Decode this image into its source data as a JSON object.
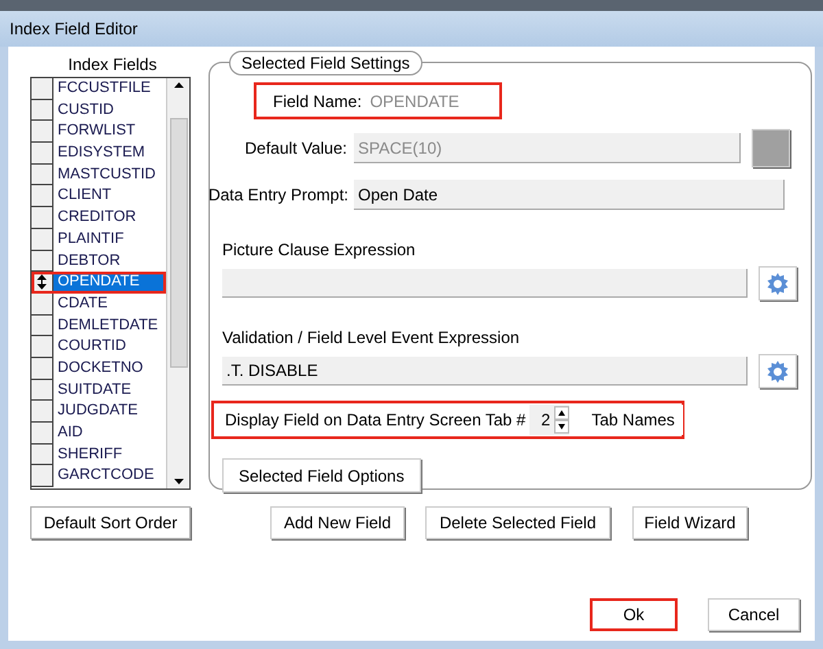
{
  "window": {
    "title": "Index Field Editor"
  },
  "index_fields": {
    "label": "Index Fields",
    "items": [
      {
        "name": "FCCUSTFILE",
        "selected": false
      },
      {
        "name": "CUSTID",
        "selected": false
      },
      {
        "name": "FORWLIST",
        "selected": false
      },
      {
        "name": "EDISYSTEM",
        "selected": false
      },
      {
        "name": "MASTCUSTID",
        "selected": false
      },
      {
        "name": "CLIENT",
        "selected": false
      },
      {
        "name": "CREDITOR",
        "selected": false
      },
      {
        "name": "PLAINTIF",
        "selected": false
      },
      {
        "name": "DEBTOR",
        "selected": false
      },
      {
        "name": "OPENDATE",
        "selected": true
      },
      {
        "name": "CDATE",
        "selected": false
      },
      {
        "name": "DEMLETDATE",
        "selected": false
      },
      {
        "name": "COURTID",
        "selected": false
      },
      {
        "name": "DOCKETNO",
        "selected": false
      },
      {
        "name": "SUITDATE",
        "selected": false
      },
      {
        "name": "JUDGDATE",
        "selected": false
      },
      {
        "name": "AID",
        "selected": false
      },
      {
        "name": "SHERIFF",
        "selected": false
      },
      {
        "name": "GARCTCODE",
        "selected": false
      }
    ]
  },
  "settings": {
    "legend": "Selected Field Settings",
    "field_name": {
      "label": "Field Name:",
      "value": "OPENDATE",
      "highlighted": true
    },
    "default_value": {
      "label": "Default Value:",
      "value": "SPACE(10)",
      "disabled": true
    },
    "prompt": {
      "label": "Data Entry Prompt:",
      "value": "Open Date",
      "disabled": false
    },
    "picture_clause": {
      "label": "Picture Clause Expression"
    },
    "validation": {
      "label": "Validation / Field Level Event Expression",
      "value": ".T. DISABLE"
    },
    "tab_row": {
      "label": "Display Field on Data Entry Screen Tab #",
      "value": "2",
      "button": "Tab Names",
      "highlighted": true
    },
    "options_button": "Selected Field Options"
  },
  "buttons": [
    "Default Sort Order",
    "Add New Field",
    "Delete Selected Field",
    "Field Wizard"
  ],
  "dialog_buttons": [
    {
      "label": "Ok",
      "highlighted": true
    },
    {
      "label": "Cancel",
      "highlighted": false
    }
  ]
}
